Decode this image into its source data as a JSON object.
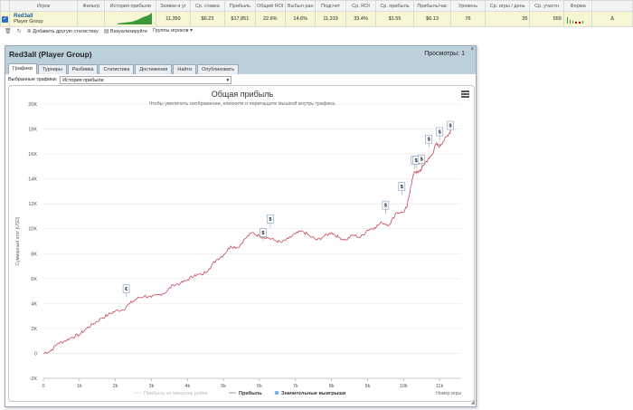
{
  "stats": {
    "columns": [
      "",
      "Игрок",
      "Фильтр",
      "История прибыли",
      "Заявки и уг",
      "Ср. ставка",
      "Прибыль",
      "Общий ROI",
      "Выбыл ран",
      "Подсчет",
      "Ср. ROI",
      "Ср. прибыль",
      "Прибыль/час",
      "Уровень",
      "Ср. игры / день",
      "Ср. участн",
      "Форма",
      ""
    ],
    "row": {
      "player_name": "Red3all",
      "player_group": "Player Group",
      "filter": "",
      "entries": "11,350",
      "avg_stake": "$6.23",
      "profit": "$17,851",
      "total_roi": "22.6%",
      "itm": "14.6%",
      "count": "11,319",
      "avg_roi": "33.4%",
      "avg_profit": "$1.55",
      "profit_per_hour": "$6.13",
      "level": "76",
      "games_per_day": "35",
      "avg_field": "559",
      "extra": "Δ"
    },
    "sparkline_color": "#3a9a3a"
  },
  "toolbar": {
    "add_label": "Добавить другую статистику",
    "visualize_label": "Визуализируйте",
    "groups_label": "Группы игроков"
  },
  "modal": {
    "title": "Red3all (Player Group)",
    "views": "Просмотры: 1",
    "close": "×",
    "tabs": [
      "Графики",
      "Турниры",
      "Разбивка",
      "Статистика",
      "Достижения",
      "Найти",
      "Опубликовать"
    ],
    "select_label": "Выбранные графики:",
    "select_value": "История прибыли"
  },
  "chart_data": {
    "type": "line",
    "title": "Общая прибыль",
    "subtitle": "Чтобы увеличить изображение, кликните и перетащите мышкой внутрь графика.",
    "ylabel": "Суммарный итог (USD)",
    "xlabel": "Номер игры",
    "ylim": [
      -2000,
      20000
    ],
    "xlim": [
      0,
      11600
    ],
    "yticks": [
      "-2K",
      "0",
      "2K",
      "4K",
      "6K",
      "8K",
      "10K",
      "12K",
      "14K",
      "16K",
      "18K",
      "20K"
    ],
    "xticks": [
      "0",
      "1k",
      "2k",
      "3k",
      "4k",
      "5k",
      "6k",
      "7k",
      "8k",
      "9k",
      "10k",
      "11k"
    ],
    "grid": true,
    "line_color": "#c9485a",
    "series": [
      {
        "name": "Прибыль",
        "x": [
          0,
          200,
          400,
          600,
          800,
          1000,
          1200,
          1400,
          1600,
          1800,
          2000,
          2200,
          2400,
          2600,
          2800,
          3000,
          3200,
          3400,
          3600,
          3800,
          4000,
          4200,
          4400,
          4600,
          4800,
          5000,
          5200,
          5400,
          5600,
          5800,
          6000,
          6200,
          6400,
          6600,
          6800,
          7000,
          7200,
          7400,
          7600,
          7800,
          8000,
          8200,
          8400,
          8600,
          8800,
          9000,
          9200,
          9400,
          9600,
          9800,
          10000,
          10100,
          10200,
          10300,
          10400,
          10500,
          10600,
          10700,
          10800,
          10900,
          11000,
          11100,
          11200,
          11319
        ],
        "values": [
          0,
          200,
          800,
          1000,
          1300,
          1500,
          2000,
          2400,
          2800,
          3100,
          3400,
          3500,
          4000,
          4400,
          4600,
          4500,
          4700,
          4900,
          5500,
          5600,
          5900,
          6300,
          6300,
          6800,
          7500,
          7900,
          8600,
          8500,
          9200,
          9700,
          9400,
          9300,
          9100,
          8900,
          9200,
          9600,
          9800,
          9400,
          9100,
          9400,
          9700,
          9300,
          9100,
          9500,
          9300,
          9900,
          10100,
          10500,
          10300,
          11300,
          11300,
          11800,
          13400,
          14600,
          14500,
          14800,
          15300,
          15600,
          16000,
          16800,
          16600,
          17000,
          17400,
          17900
        ]
      }
    ],
    "big_wins": {
      "name": "Значительные выигрыши",
      "x": [
        2300,
        6100,
        6300,
        9500,
        9950,
        10300,
        10350,
        10500,
        10700,
        11000,
        11300
      ],
      "values": [
        4500,
        9000,
        10100,
        11200,
        12700,
        14800,
        14800,
        14900,
        16500,
        17100,
        17600
      ],
      "labels": [
        "€",
        "$",
        "$",
        "$",
        "$",
        "€",
        "$",
        "$",
        "$",
        "$",
        "$"
      ]
    },
    "legend": [
      {
        "label": "Прибыль за минусом рейка"
      },
      {
        "label": "Прибыль"
      },
      {
        "label": "Значительные выигрыши"
      }
    ]
  }
}
